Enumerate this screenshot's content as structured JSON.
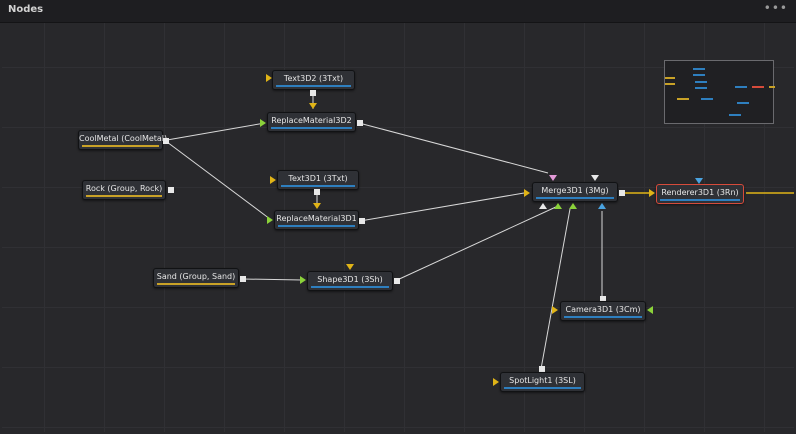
{
  "panel": {
    "title": "Nodes",
    "menu_label": "•••"
  },
  "colors": {
    "wire": "#d8d8d8",
    "output_wire": "#e0b417",
    "tool_bar": "#2e7fbf",
    "material_bar": "#c9a227",
    "selected_border": "#d64b3b"
  },
  "nodes": {
    "text3d2": {
      "label": "Text3D2  (3Txt)"
    },
    "replace2": {
      "label": "ReplaceMaterial3D2"
    },
    "coolmetal": {
      "label": "CoolMetal  (CoolMetal)"
    },
    "rock": {
      "label": "Rock  (Group, Rock)"
    },
    "text3d1": {
      "label": "Text3D1  (3Txt)"
    },
    "replace1": {
      "label": "ReplaceMaterial3D1"
    },
    "merge": {
      "label": "Merge3D1  (3Mg)"
    },
    "renderer": {
      "label": "Renderer3D1  (3Rn)"
    },
    "sand": {
      "label": "Sand  (Group, Sand)"
    },
    "shape": {
      "label": "Shape3D1  (3Sh)"
    },
    "camera": {
      "label": "Camera3D1  (3Cm)"
    },
    "spotlight": {
      "label": "SpotLight1  (3SL)"
    }
  }
}
